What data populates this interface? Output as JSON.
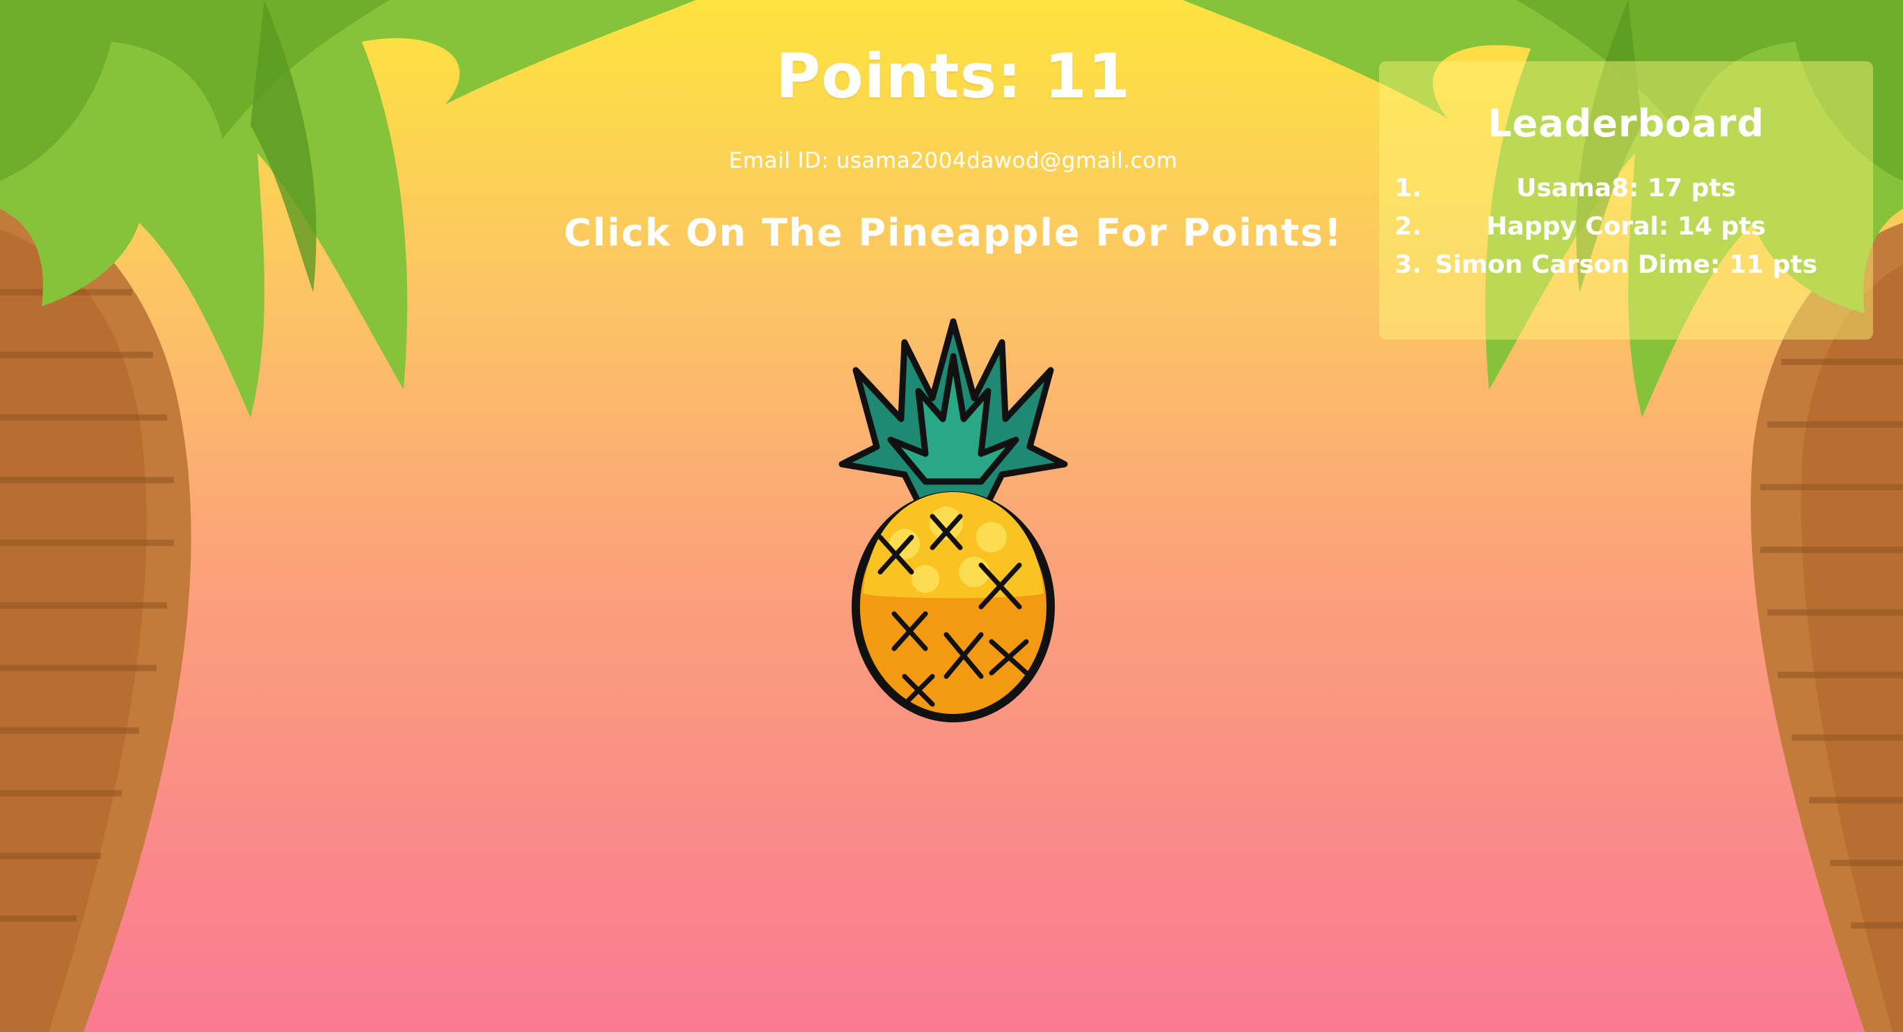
{
  "header": {
    "points_label": "Points: 11",
    "email_line": "Email ID: usama2004dawod@gmail.com",
    "instruction": "Click On The Pineapple For Points!"
  },
  "game": {
    "clickable_icon": "pineapple-icon"
  },
  "leaderboard": {
    "title": "Leaderboard",
    "entries": [
      {
        "rank": "1.",
        "text": "Usama8: 17 pts"
      },
      {
        "rank": "2.",
        "text": "Happy Coral: 14 pts"
      },
      {
        "rank": "3.",
        "text": "Simon Carson Dime: 11 pts"
      }
    ]
  },
  "colors": {
    "sky_top": "#fde33f",
    "sky_bottom": "#f97a93",
    "palm_leaf": "#7fbe2e",
    "palm_trunk": "#c47a3a",
    "text": "#ffffff",
    "panel": "#fff678"
  }
}
